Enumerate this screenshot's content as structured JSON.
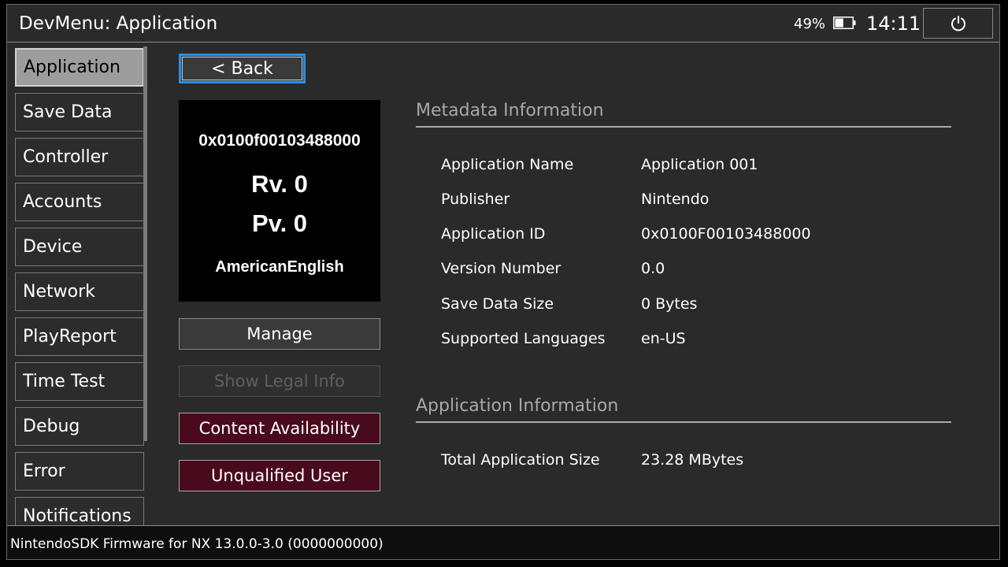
{
  "header": {
    "title": "DevMenu: Application",
    "battery_percent": "49%",
    "battery_level": 0.49,
    "clock": "14:11",
    "power_icon": "power-icon"
  },
  "sidebar": {
    "items": [
      {
        "label": "Application"
      },
      {
        "label": "Save Data"
      },
      {
        "label": "Controller"
      },
      {
        "label": "Accounts"
      },
      {
        "label": "Device"
      },
      {
        "label": "Network"
      },
      {
        "label": "PlayReport"
      },
      {
        "label": "Time Test"
      },
      {
        "label": "Debug"
      },
      {
        "label": "Error"
      },
      {
        "label": "Notifications"
      }
    ]
  },
  "back_button": "< Back",
  "thumbnail": {
    "app_id": "0x0100f00103488000",
    "revision": "Rv. 0",
    "patch_version": "Pv. 0",
    "language": "AmericanEnglish"
  },
  "actions": {
    "manage": "Manage",
    "legal_info": "Show Legal Info",
    "content_availability": "Content Availability",
    "unqualified_user": "Unqualified User"
  },
  "metadata": {
    "title": "Metadata Information",
    "rows": [
      {
        "label": "Application Name",
        "value": "Application 001"
      },
      {
        "label": "Publisher",
        "value": "Nintendo"
      },
      {
        "label": "Application ID",
        "value": "0x0100F00103488000"
      },
      {
        "label": "Version Number",
        "value": "0.0"
      },
      {
        "label": "Save Data Size",
        "value": "0 Bytes"
      },
      {
        "label": "Supported Languages",
        "value": "en-US"
      }
    ]
  },
  "app_info": {
    "title": "Application Information",
    "rows": [
      {
        "label": "Total Application Size",
        "value": "23.28 MBytes"
      }
    ]
  },
  "footer": {
    "text": "NintendoSDK Firmware for NX 13.0.0-3.0 (0000000000)"
  },
  "colors": {
    "background": "#2a2a2a",
    "accent_blue": "#2e8de0",
    "red_button": "#4a0a1e",
    "sidebar_active": "#9d9d9d"
  }
}
